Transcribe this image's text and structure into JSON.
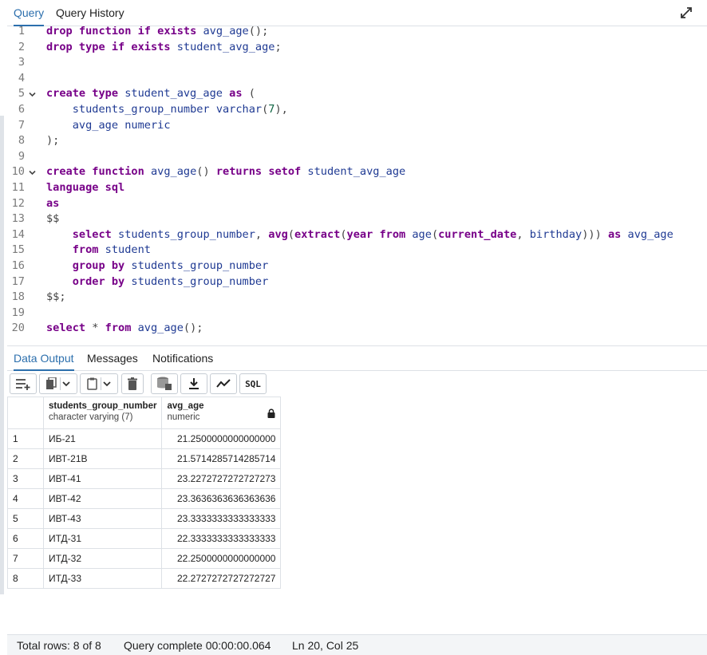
{
  "tabs": {
    "query": "Query",
    "history": "Query History"
  },
  "editor": {
    "lines": [
      {
        "n": "1",
        "fold": "",
        "tokens": [
          [
            "kw",
            "drop "
          ],
          [
            "kw",
            "function "
          ],
          [
            "kw",
            "if "
          ],
          [
            "kw",
            "exists "
          ],
          [
            "id",
            "avg_age"
          ],
          [
            "pun",
            "();"
          ]
        ]
      },
      {
        "n": "2",
        "fold": "",
        "tokens": [
          [
            "kw",
            "drop "
          ],
          [
            "kw",
            "type "
          ],
          [
            "kw",
            "if "
          ],
          [
            "kw",
            "exists "
          ],
          [
            "id",
            "student_avg_age"
          ],
          [
            "pun",
            ";"
          ]
        ]
      },
      {
        "n": "3",
        "fold": "",
        "tokens": []
      },
      {
        "n": "4",
        "fold": "",
        "tokens": []
      },
      {
        "n": "5",
        "fold": "v",
        "tokens": [
          [
            "kw",
            "create "
          ],
          [
            "kw",
            "type "
          ],
          [
            "id",
            "student_avg_age "
          ],
          [
            "kw",
            "as "
          ],
          [
            "pun",
            "("
          ]
        ]
      },
      {
        "n": "6",
        "fold": "",
        "tokens": [
          [
            "pun",
            "    "
          ],
          [
            "id",
            "students_group_number "
          ],
          [
            "id",
            "varchar"
          ],
          [
            "pun",
            "("
          ],
          [
            "num",
            "7"
          ],
          [
            "pun",
            "),"
          ]
        ]
      },
      {
        "n": "7",
        "fold": "",
        "tokens": [
          [
            "pun",
            "    "
          ],
          [
            "id",
            "avg_age "
          ],
          [
            "id",
            "numeric"
          ]
        ]
      },
      {
        "n": "8",
        "fold": "",
        "tokens": [
          [
            "pun",
            ");"
          ]
        ]
      },
      {
        "n": "9",
        "fold": "",
        "tokens": []
      },
      {
        "n": "10",
        "fold": "v",
        "tokens": [
          [
            "kw",
            "create "
          ],
          [
            "kw",
            "function "
          ],
          [
            "id",
            "avg_age"
          ],
          [
            "pun",
            "() "
          ],
          [
            "kw",
            "returns "
          ],
          [
            "kw",
            "setof "
          ],
          [
            "id",
            "student_avg_age"
          ]
        ]
      },
      {
        "n": "11",
        "fold": "",
        "tokens": [
          [
            "kw",
            "language "
          ],
          [
            "kw",
            "sql"
          ]
        ]
      },
      {
        "n": "12",
        "fold": "",
        "tokens": [
          [
            "kw",
            "as"
          ]
        ]
      },
      {
        "n": "13",
        "fold": "",
        "tokens": [
          [
            "pun",
            "$$"
          ]
        ]
      },
      {
        "n": "14",
        "fold": "",
        "tokens": [
          [
            "pun",
            "    "
          ],
          [
            "kw",
            "select "
          ],
          [
            "id",
            "students_group_number"
          ],
          [
            "pun",
            ", "
          ],
          [
            "kw",
            "avg"
          ],
          [
            "pun",
            "("
          ],
          [
            "kw",
            "extract"
          ],
          [
            "pun",
            "("
          ],
          [
            "kw",
            "year "
          ],
          [
            "kw",
            "from "
          ],
          [
            "id",
            "age"
          ],
          [
            "pun",
            "("
          ],
          [
            "kw",
            "current_date"
          ],
          [
            "pun",
            ", "
          ],
          [
            "id",
            "birthday"
          ],
          [
            "pun",
            "))) "
          ],
          [
            "kw",
            "as "
          ],
          [
            "id",
            "avg_age"
          ]
        ]
      },
      {
        "n": "15",
        "fold": "",
        "tokens": [
          [
            "pun",
            "    "
          ],
          [
            "kw",
            "from "
          ],
          [
            "id",
            "student"
          ]
        ]
      },
      {
        "n": "16",
        "fold": "",
        "tokens": [
          [
            "pun",
            "    "
          ],
          [
            "kw",
            "group "
          ],
          [
            "kw",
            "by "
          ],
          [
            "id",
            "students_group_number"
          ]
        ]
      },
      {
        "n": "17",
        "fold": "",
        "tokens": [
          [
            "pun",
            "    "
          ],
          [
            "kw",
            "order "
          ],
          [
            "kw",
            "by "
          ],
          [
            "id",
            "students_group_number"
          ]
        ]
      },
      {
        "n": "18",
        "fold": "",
        "tokens": [
          [
            "pun",
            "$$;"
          ]
        ]
      },
      {
        "n": "19",
        "fold": "",
        "tokens": []
      },
      {
        "n": "20",
        "fold": "",
        "tokens": [
          [
            "kw",
            "select "
          ],
          [
            "op",
            "* "
          ],
          [
            "kw",
            "from "
          ],
          [
            "id",
            "avg_age"
          ],
          [
            "pun",
            "();"
          ]
        ]
      }
    ]
  },
  "output_tabs": {
    "data_output": "Data Output",
    "messages": "Messages",
    "notifications": "Notifications"
  },
  "toolbar": {
    "sql_label": "SQL"
  },
  "grid": {
    "columns": [
      {
        "name": "students_group_number",
        "type": "character varying (7)"
      },
      {
        "name": "avg_age",
        "type": "numeric"
      }
    ],
    "rows": [
      [
        "1",
        "ИБ-21",
        "21.2500000000000000"
      ],
      [
        "2",
        "ИВТ-21В",
        "21.5714285714285714"
      ],
      [
        "3",
        "ИВТ-41",
        "23.2272727272727273"
      ],
      [
        "4",
        "ИВТ-42",
        "23.3636363636363636"
      ],
      [
        "5",
        "ИВТ-43",
        "23.3333333333333333"
      ],
      [
        "6",
        "ИТД-31",
        "22.3333333333333333"
      ],
      [
        "7",
        "ИТД-32",
        "22.2500000000000000"
      ],
      [
        "8",
        "ИТД-33",
        "22.2727272727272727"
      ]
    ]
  },
  "status": {
    "total_rows": "Total rows: 8 of 8",
    "query_complete": "Query complete 00:00:00.064",
    "position": "Ln 20, Col 25"
  }
}
